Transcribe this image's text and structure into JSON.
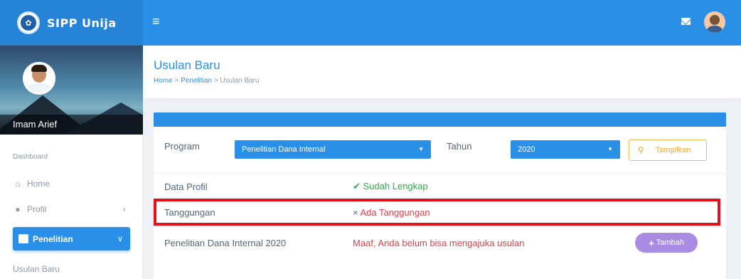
{
  "brand": {
    "title": "SIPP Unija"
  },
  "user": {
    "name": "Imam Arief"
  },
  "sidebar": {
    "section_label": "Dashboard",
    "items": [
      {
        "label": "Home"
      },
      {
        "label": "Profil"
      },
      {
        "label": "Penelitian"
      },
      {
        "label": "Usulan Baru"
      }
    ]
  },
  "header": {
    "title": "Usulan Baru",
    "breadcrumb": [
      "Home",
      "Penelitian",
      "Usulan Baru"
    ],
    "separator": ">"
  },
  "filters": {
    "program_label": "Program",
    "program_value": "Penelitian Dana Internal",
    "tahun_label": "Tahun",
    "tahun_value": "2020",
    "show_button": "Tampilkan"
  },
  "rows": [
    {
      "label": "Data Profil",
      "status": "Sudah Lengkap",
      "status_icon": "✔",
      "status_color": "#32a852"
    },
    {
      "label": "Tanggungan",
      "status": "Ada Tanggungan",
      "status_icon": "×",
      "status_color": "#e0404a"
    },
    {
      "label": "Penelitian Dana Internal 2020",
      "status": "Maaf, Anda belum bisa mengajuka usulan",
      "status_color": "#e0404a"
    }
  ],
  "add_button": "Tambah",
  "colors": {
    "primary": "#2a8fe6",
    "warning": "#f5a623",
    "success": "#32a852",
    "danger": "#e0404a",
    "highlight": "#e5101a",
    "add_button": "#ab8ce4"
  }
}
